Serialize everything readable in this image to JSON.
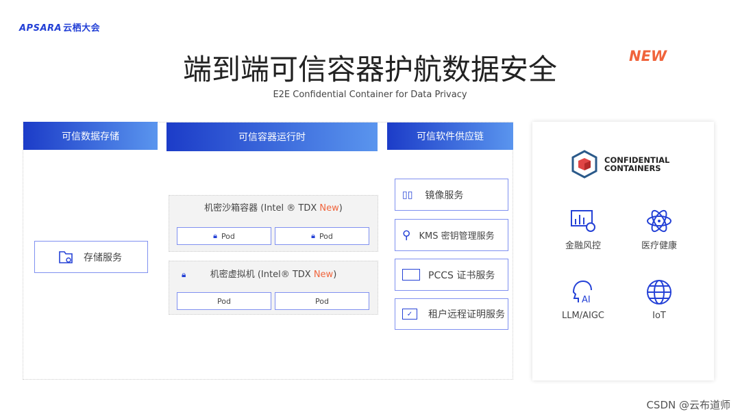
{
  "logo": {
    "brand": "APSARA",
    "cn": "云栖大会"
  },
  "title": "端到端可信容器护航数据安全",
  "subtitle": "E2E Confidential Container for Data Privacy",
  "new_tag": "NEW",
  "columns": {
    "storage": {
      "header": "可信数据存储",
      "service": "存储服务"
    },
    "runtime": {
      "header": "可信容器运行时",
      "sandbox": {
        "title": "机密沙箱容器 (Intel ® TDX ",
        "new": "New",
        "close": ")",
        "pods": [
          "Pod",
          "Pod"
        ]
      },
      "vm": {
        "title": "机密虚拟机 (Intel® TDX ",
        "new": "New",
        "close": ")",
        "pods": [
          "Pod",
          "Pod"
        ]
      }
    },
    "supply": {
      "header": "可信软件供应链",
      "services": [
        "镜像服务",
        "KMS 密钥管理服务",
        "PCCS 证书服务",
        "租户远程证明服务"
      ]
    }
  },
  "card": {
    "brand_line1": "CONFIDENTIAL",
    "brand_line2": "CONTAINERS",
    "apps": [
      "金融风控",
      "医疗健康",
      "LLM/AIGC",
      "IoT"
    ]
  },
  "watermark": "CSDN @云布道师",
  "colors": {
    "accent": "#2340d6",
    "new": "#f0643c"
  }
}
